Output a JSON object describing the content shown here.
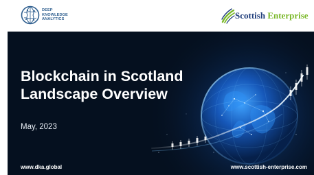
{
  "header": {
    "dka_logo": {
      "line1": "DEEP",
      "line2": "KNOWLEDGE",
      "line3": "ANALYTICS",
      "icon": "brain-globe-icon"
    },
    "se_logo": {
      "part1": "Scottish",
      "part2": "Enterprise",
      "icon": "swirl-icon"
    }
  },
  "hero": {
    "title_line1": "Blockchain in Scotland",
    "title_line2": "Landscape Overview",
    "date": "May, 2023",
    "footer_left": "www.dka.global",
    "footer_right": "www.scottish-enterprise.com"
  },
  "colors": {
    "hero_background": "#05101f",
    "globe_glow": "#1e6fd9",
    "dka_blue": "#2f5f8f",
    "se_navy": "#1f3d7a",
    "se_green": "#7ab828"
  }
}
